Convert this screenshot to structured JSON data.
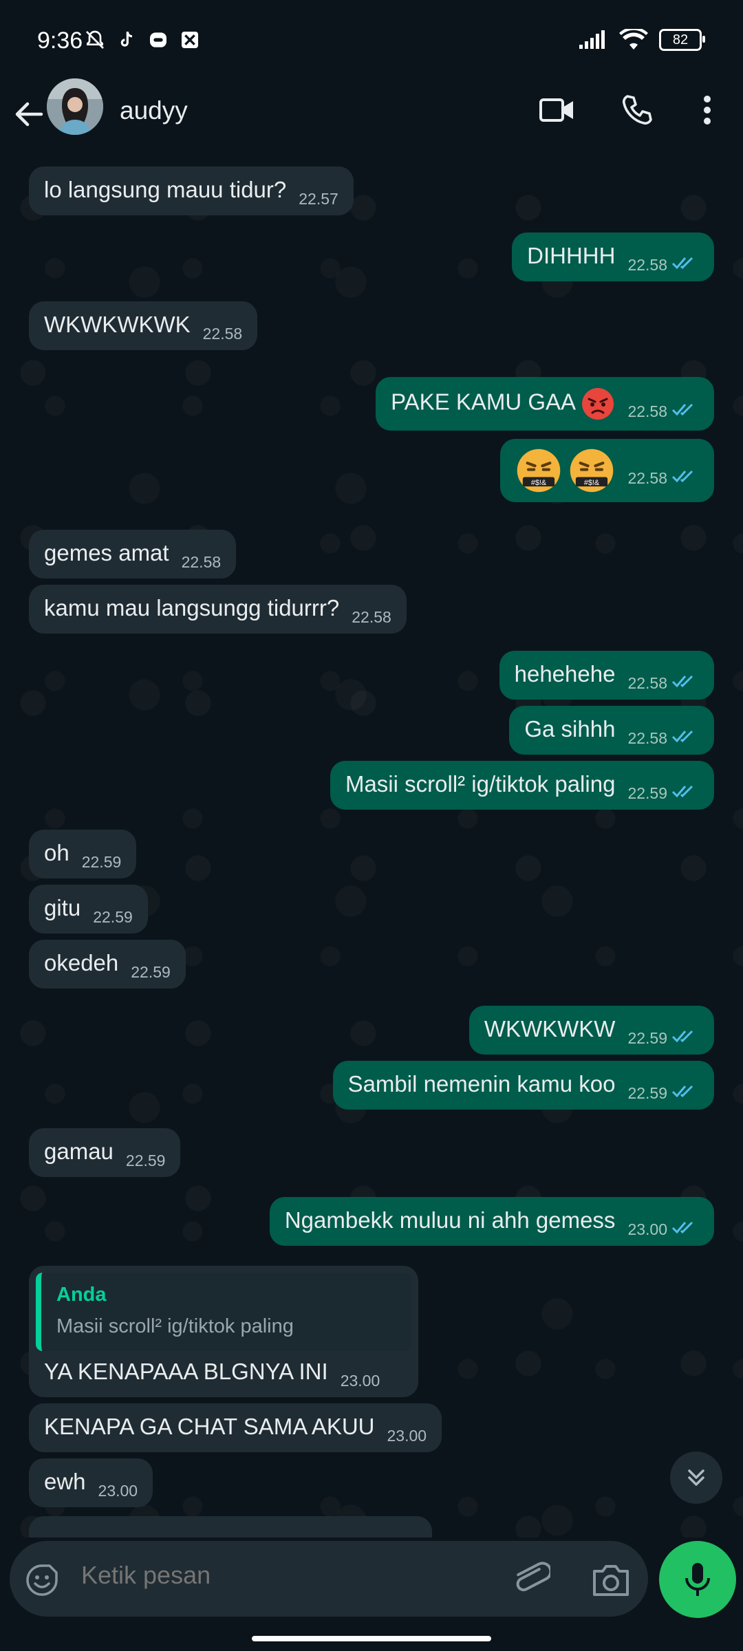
{
  "status_bar": {
    "time": "9:36",
    "battery": "82"
  },
  "header": {
    "contact_name": "audyy"
  },
  "messages": [
    {
      "dir": "in",
      "text": "lo langsung mauu tidur?",
      "time": "22.57"
    },
    {
      "dir": "out",
      "text": "DIHHHH",
      "time": "22.58"
    },
    {
      "dir": "in",
      "text": "WKWKWKWK",
      "time": "22.58"
    },
    {
      "dir": "out",
      "text": "PAKE KAMU GAA",
      "time": "22.58"
    },
    {
      "dir": "out",
      "text": "",
      "time": "22.58"
    },
    {
      "dir": "in",
      "text": "gemes amat",
      "time": "22.58"
    },
    {
      "dir": "in",
      "text": "kamu mau langsungg tidurrr?",
      "time": "22.58"
    },
    {
      "dir": "out",
      "text": "hehehehe",
      "time": "22.58"
    },
    {
      "dir": "out",
      "text": "Ga sihhh",
      "time": "22.58"
    },
    {
      "dir": "out",
      "text": "Masii scroll² ig/tiktok paling",
      "time": "22.59"
    },
    {
      "dir": "in",
      "text": "oh",
      "time": "22.59"
    },
    {
      "dir": "in",
      "text": "gitu",
      "time": "22.59"
    },
    {
      "dir": "in",
      "text": "okedeh",
      "time": "22.59"
    },
    {
      "dir": "out",
      "text": "WKWKWKW",
      "time": "22.59"
    },
    {
      "dir": "out",
      "text": "Sambil nemenin kamu koo",
      "time": "22.59"
    },
    {
      "dir": "in",
      "text": "gamau",
      "time": "22.59"
    },
    {
      "dir": "out",
      "text": "Ngambekk muluu ni ahh gemess",
      "time": "23.00"
    },
    {
      "dir": "in",
      "text": "YA KENAPAAA BLGNYA INI",
      "time": "23.00",
      "quote": {
        "author": "Anda",
        "text": "Masii scroll² ig/tiktok paling"
      }
    },
    {
      "dir": "in",
      "text": "KENAPA GA CHAT SAMA AKUU",
      "time": "23.00"
    },
    {
      "dir": "in",
      "text": "ewh",
      "time": "23.00"
    }
  ],
  "composer": {
    "placeholder": "Ketik pesan"
  },
  "icons": {
    "emoji_angry": "angry-face-emoji",
    "emoji_cursing": "face-with-symbols-emoji",
    "read_ticks_color": "#53bdeb"
  }
}
